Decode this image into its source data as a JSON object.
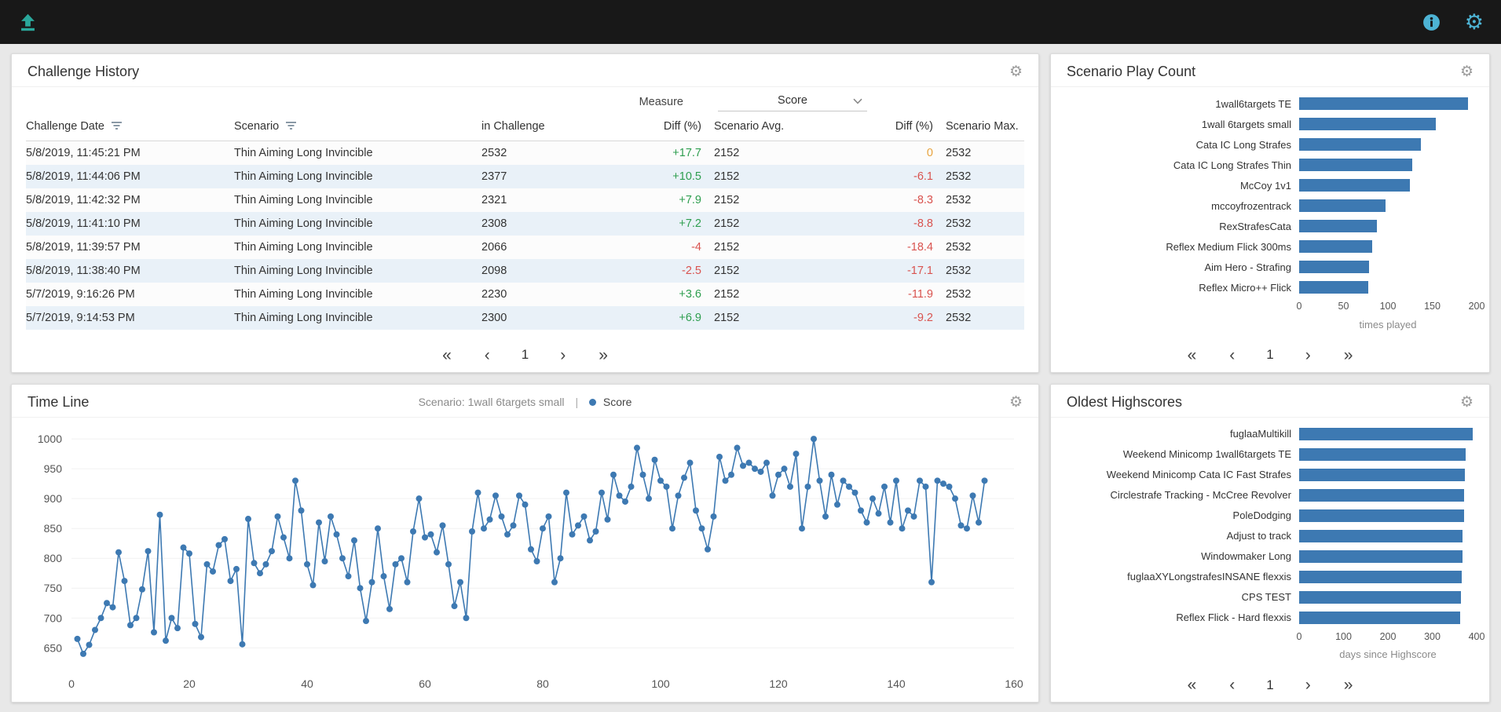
{
  "icons": {
    "upload": "⬆",
    "info": "ℹ",
    "settings": "⚙",
    "filter": "filter-lines",
    "dropdown": "▾",
    "first_page": "«",
    "prev_page": "‹",
    "next_page": "›",
    "last_page": "»",
    "legend_dot": "●"
  },
  "colors": {
    "accent_bar": "#3d79b2",
    "positive": "#2e9e4f",
    "negative": "#d9534f",
    "zero": "#e8a33d",
    "header_icon_teal": "#2aa79b",
    "header_icon_blue": "#4db3d4"
  },
  "challenge_history": {
    "title": "Challenge History",
    "measure_label": "Measure",
    "measure_value": "Score",
    "page": "1",
    "columns": [
      {
        "label": "Challenge Date",
        "filter": true,
        "align": "left"
      },
      {
        "label": "Scenario",
        "filter": true,
        "align": "left"
      },
      {
        "label": "in Challenge",
        "filter": false,
        "align": "left"
      },
      {
        "label": "Diff (%)",
        "filter": false,
        "align": "right"
      },
      {
        "label": "Scenario Avg.",
        "filter": false,
        "align": "left"
      },
      {
        "label": "Diff (%)",
        "filter": false,
        "align": "right"
      },
      {
        "label": "Scenario Max.",
        "filter": false,
        "align": "left"
      }
    ],
    "rows": [
      {
        "date": "5/8/2019, 11:45:21 PM",
        "scenario": "Thin Aiming Long Invincible",
        "in_challenge": "2532",
        "diff_challenge": "+17.7",
        "scenario_avg": "2152",
        "diff_avg": "0",
        "scenario_max": "2532"
      },
      {
        "date": "5/8/2019, 11:44:06 PM",
        "scenario": "Thin Aiming Long Invincible",
        "in_challenge": "2377",
        "diff_challenge": "+10.5",
        "scenario_avg": "2152",
        "diff_avg": "-6.1",
        "scenario_max": "2532"
      },
      {
        "date": "5/8/2019, 11:42:32 PM",
        "scenario": "Thin Aiming Long Invincible",
        "in_challenge": "2321",
        "diff_challenge": "+7.9",
        "scenario_avg": "2152",
        "diff_avg": "-8.3",
        "scenario_max": "2532"
      },
      {
        "date": "5/8/2019, 11:41:10 PM",
        "scenario": "Thin Aiming Long Invincible",
        "in_challenge": "2308",
        "diff_challenge": "+7.2",
        "scenario_avg": "2152",
        "diff_avg": "-8.8",
        "scenario_max": "2532"
      },
      {
        "date": "5/8/2019, 11:39:57 PM",
        "scenario": "Thin Aiming Long Invincible",
        "in_challenge": "2066",
        "diff_challenge": "-4",
        "scenario_avg": "2152",
        "diff_avg": "-18.4",
        "scenario_max": "2532"
      },
      {
        "date": "5/8/2019, 11:38:40 PM",
        "scenario": "Thin Aiming Long Invincible",
        "in_challenge": "2098",
        "diff_challenge": "-2.5",
        "scenario_avg": "2152",
        "diff_avg": "-17.1",
        "scenario_max": "2532"
      },
      {
        "date": "5/7/2019, 9:16:26 PM",
        "scenario": "Thin Aiming Long Invincible",
        "in_challenge": "2230",
        "diff_challenge": "+3.6",
        "scenario_avg": "2152",
        "diff_avg": "-11.9",
        "scenario_max": "2532"
      },
      {
        "date": "5/7/2019, 9:14:53 PM",
        "scenario": "Thin Aiming Long Invincible",
        "in_challenge": "2300",
        "diff_challenge": "+6.9",
        "scenario_avg": "2152",
        "diff_avg": "-9.2",
        "scenario_max": "2532"
      }
    ]
  },
  "scenario_play_count": {
    "title": "Scenario Play Count",
    "page": "1"
  },
  "timeline": {
    "title": "Time Line",
    "scenario_label": "Scenario: 1wall 6targets small",
    "separator": "|",
    "legend_label": "Score"
  },
  "oldest_highscores": {
    "title": "Oldest Highscores",
    "page": "1"
  },
  "chart_data": [
    {
      "id": "scenario_play_count",
      "type": "bar",
      "orientation": "horizontal",
      "categories": [
        "1wall6targets TE",
        "1wall 6targets small",
        "Cata IC Long Strafes",
        "Cata IC Long Strafes Thin",
        "McCoy 1v1",
        "mccoyfrozentrack",
        "RexStrafesCata",
        "Reflex Medium Flick 300ms",
        "Aim Hero - Strafing",
        "Reflex Micro++ Flick"
      ],
      "values": [
        190,
        154,
        137,
        127,
        125,
        97,
        88,
        82,
        79,
        78
      ],
      "xlabel": "times played",
      "xlim": [
        0,
        200
      ],
      "xticks": [
        0,
        50,
        100,
        150,
        200
      ]
    },
    {
      "id": "timeline",
      "type": "line",
      "title": "Time Line",
      "xlim": [
        0,
        160
      ],
      "ylim": [
        628,
        1012
      ],
      "xticks": [
        0,
        20,
        40,
        60,
        80,
        100,
        120,
        140,
        160
      ],
      "yticks": [
        650,
        700,
        750,
        800,
        850,
        900,
        950,
        1000
      ],
      "series": [
        {
          "name": "Score",
          "values": [
            665,
            640,
            655,
            680,
            700,
            725,
            718,
            810,
            762,
            688,
            700,
            748,
            812,
            676,
            873,
            662,
            700,
            683,
            818,
            808,
            690,
            668,
            790,
            778,
            822,
            832,
            762,
            782,
            656,
            866,
            792,
            775,
            790,
            812,
            870,
            835,
            800,
            930,
            880,
            790,
            755,
            860,
            795,
            870,
            840,
            800,
            770,
            830,
            750,
            695,
            760,
            850,
            770,
            715,
            790,
            800,
            760,
            845,
            900,
            835,
            840,
            810,
            855,
            790,
            720,
            760,
            700,
            845,
            910,
            850,
            865,
            905,
            870,
            840,
            855,
            905,
            890,
            815,
            795,
            850,
            870,
            760,
            800,
            910,
            840,
            855,
            870,
            830,
            845,
            910,
            865,
            940,
            905,
            895,
            920,
            985,
            940,
            900,
            965,
            930,
            920,
            850,
            905,
            935,
            960,
            880,
            850,
            815,
            870,
            970,
            930,
            940,
            985,
            955,
            960,
            950,
            945,
            960,
            905,
            940,
            950,
            920,
            975,
            850,
            920,
            1000,
            930,
            870,
            940,
            890,
            930,
            920,
            910,
            880,
            860,
            900,
            875,
            920,
            860,
            930,
            850,
            880,
            870,
            930,
            920,
            760,
            930,
            925,
            920,
            900,
            855,
            850,
            905,
            860,
            930
          ]
        }
      ]
    },
    {
      "id": "oldest_highscores",
      "type": "bar",
      "orientation": "horizontal",
      "categories": [
        "fuglaaMultikill",
        "Weekend Minicomp 1wall6targets TE",
        "Weekend Minicomp Cata IC Fast Strafes",
        "Circlestrafe Tracking - McCree Revolver",
        "PoleDodging",
        "Adjust to track",
        "Windowmaker Long",
        "fuglaaXYLongstrafesINSANE flexxis",
        "CPS TEST",
        "Reflex Flick - Hard flexxis"
      ],
      "values": [
        392,
        375,
        374,
        372,
        371,
        369,
        368,
        367,
        365,
        363
      ],
      "xlabel": "days since Highscore",
      "xlim": [
        0,
        400
      ],
      "xticks": [
        0,
        100,
        200,
        300,
        400
      ]
    }
  ]
}
